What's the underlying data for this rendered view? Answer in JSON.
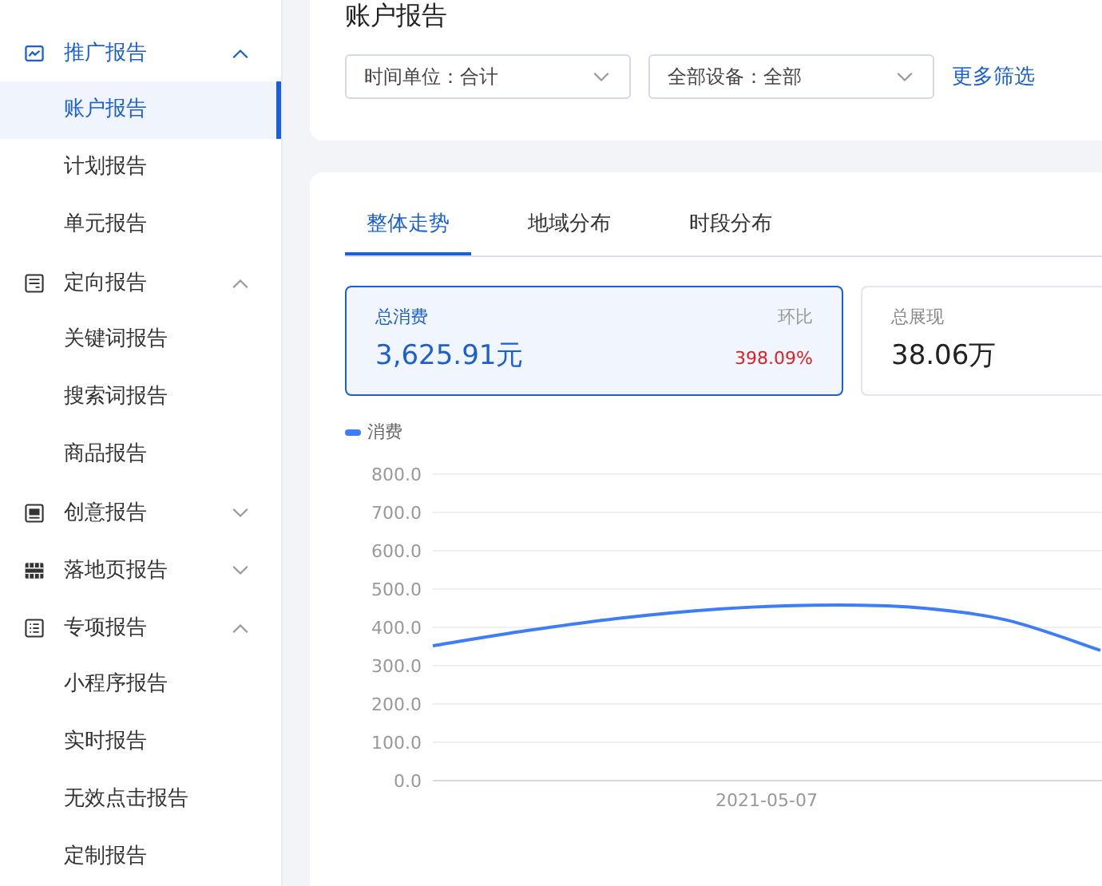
{
  "sidebar": {
    "groups": [
      {
        "label": "推广报告",
        "expanded": true,
        "children": [
          {
            "label": "账户报告",
            "selected": true
          },
          {
            "label": "计划报告",
            "selected": false
          },
          {
            "label": "单元报告",
            "selected": false
          }
        ]
      },
      {
        "label": "定向报告",
        "expanded": true,
        "children": [
          {
            "label": "关键词报告",
            "selected": false
          },
          {
            "label": "搜索词报告",
            "selected": false
          },
          {
            "label": "商品报告",
            "selected": false
          }
        ]
      },
      {
        "label": "创意报告",
        "expanded": false
      },
      {
        "label": "落地页报告",
        "expanded": false
      },
      {
        "label": "专项报告",
        "expanded": true,
        "children": [
          {
            "label": "小程序报告",
            "selected": false
          },
          {
            "label": "实时报告",
            "selected": false
          },
          {
            "label": "无效点击报告",
            "selected": false
          },
          {
            "label": "定制报告",
            "selected": false
          }
        ]
      }
    ]
  },
  "page_title": "账户报告",
  "filters": [
    {
      "value": "时间单位：合计"
    },
    {
      "value": "全部设备：全部"
    }
  ],
  "more_filters": "更多筛选",
  "tabs": [
    {
      "label": "整体走势",
      "selected": true
    },
    {
      "label": "地域分布",
      "selected": false
    },
    {
      "label": "时段分布",
      "selected": false
    }
  ],
  "metrics": [
    {
      "label": "总消费",
      "value": "3,625.91元",
      "compare_label": "环比",
      "compare_value": "398.09%",
      "selected": true
    },
    {
      "label": "总展现",
      "value": "38.06万",
      "selected": false
    }
  ],
  "chart": {
    "date_label": "2021-05-07",
    "chart_data": {
      "type": "line",
      "grid": true,
      "ylim": [
        0,
        800
      ],
      "yticks": [
        {
          "value": 0,
          "label": "0.0"
        },
        {
          "value": 100,
          "label": "100.0"
        },
        {
          "value": 200,
          "label": "200.0"
        },
        {
          "value": 300,
          "label": "300.0"
        },
        {
          "value": 400,
          "label": "400.0"
        },
        {
          "value": 500,
          "label": "500.0"
        },
        {
          "value": 600,
          "label": "600.0"
        },
        {
          "value": 700,
          "label": "700.0"
        },
        {
          "value": 800,
          "label": "800.0"
        }
      ],
      "series": [
        {
          "name": "消费",
          "color": "#3d7ef8",
          "values": [
            352,
            392,
            425,
            448,
            458,
            453,
            420,
            340
          ]
        }
      ]
    }
  }
}
